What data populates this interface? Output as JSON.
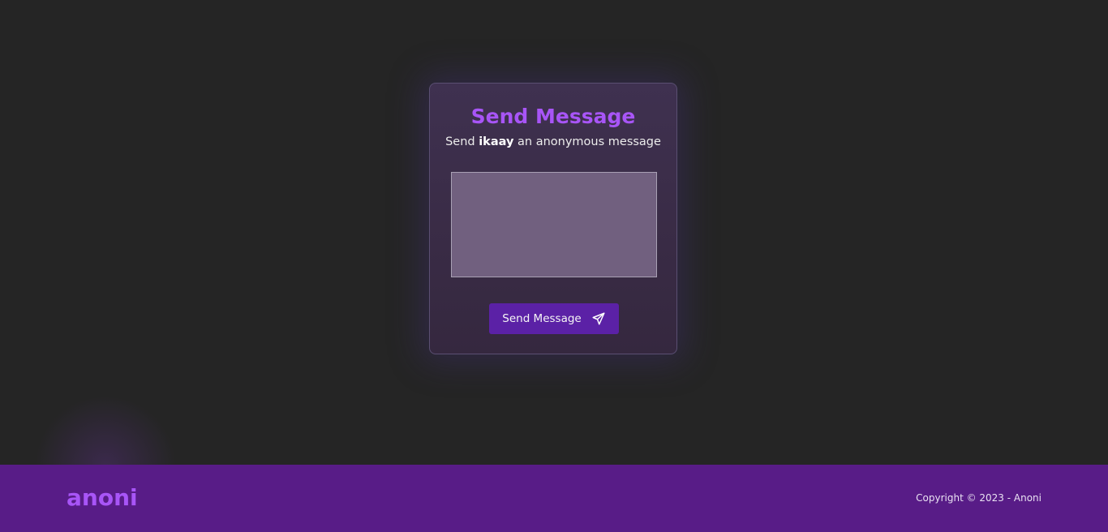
{
  "card": {
    "title": "Send Message",
    "subtitle_prefix": "Send",
    "recipient": "ikaay",
    "subtitle_suffix": "an anonymous message",
    "message": {
      "value": "",
      "placeholder": ""
    },
    "send_button": {
      "label": "Send Message",
      "icon": "paper-plane-icon"
    }
  },
  "footer": {
    "logo": "anoni",
    "copyright": "Copyright © 2023 - Anoni"
  },
  "colors": {
    "background": "#252525",
    "accent": "#a855f7",
    "button": "#5b21a6",
    "footer": "#581c87"
  }
}
